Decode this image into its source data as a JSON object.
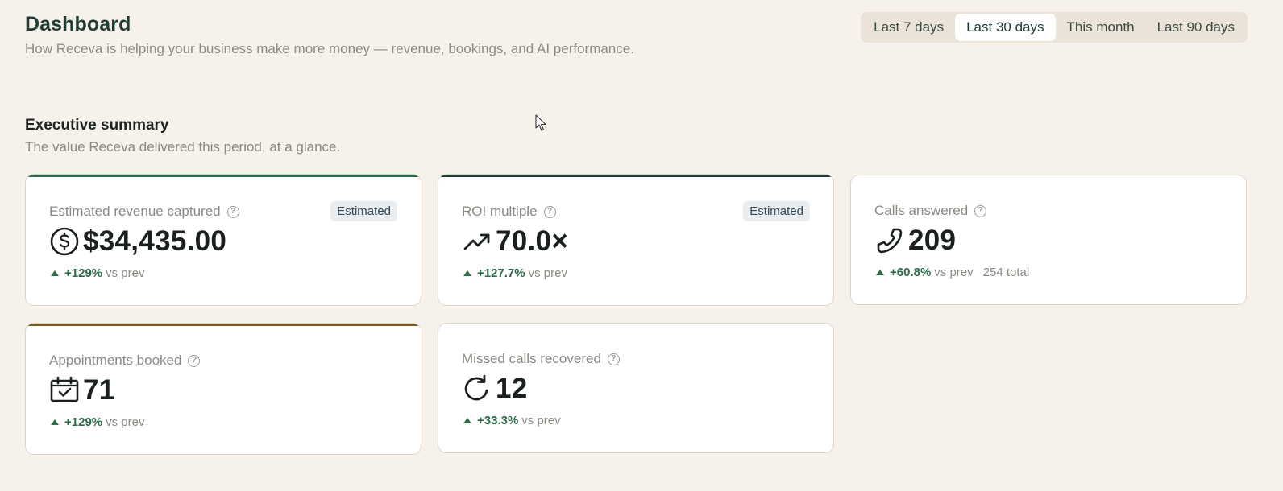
{
  "header": {
    "title": "Dashboard",
    "subtitle": "How Receva is helping your business make more money — revenue, bookings, and AI performance."
  },
  "range_tabs": [
    {
      "label": "Last 7 days",
      "active": false
    },
    {
      "label": "Last 30 days",
      "active": true
    },
    {
      "label": "This month",
      "active": false
    },
    {
      "label": "Last 90 days",
      "active": false
    }
  ],
  "section": {
    "title": "Executive summary",
    "subtitle": "The value Receva delivered this period, at a glance."
  },
  "cards": [
    {
      "label": "Estimated revenue captured",
      "badge": "Estimated",
      "icon": "dollar-circle-icon",
      "value": "$34,435.00",
      "delta": "+129%",
      "delta_note": "vs prev",
      "accent": "#2f6a4c"
    },
    {
      "label": "ROI multiple",
      "badge": "Estimated",
      "icon": "trending-up-icon",
      "value": "70.0×",
      "delta": "+127.7%",
      "delta_note": "vs prev",
      "accent": "#1f3d33"
    },
    {
      "label": "Calls answered",
      "icon": "phone-icon",
      "value": "209",
      "delta": "+60.8%",
      "delta_note": "vs prev",
      "extra": "254 total"
    },
    {
      "label": "Appointments booked",
      "icon": "calendar-check-icon",
      "value": "71",
      "delta": "+129%",
      "delta_note": "vs prev",
      "accent": "#7a5a1e"
    },
    {
      "label": "Missed calls recovered",
      "icon": "refresh-icon",
      "value": "12",
      "delta": "+33.3%",
      "delta_note": "vs prev"
    }
  ]
}
